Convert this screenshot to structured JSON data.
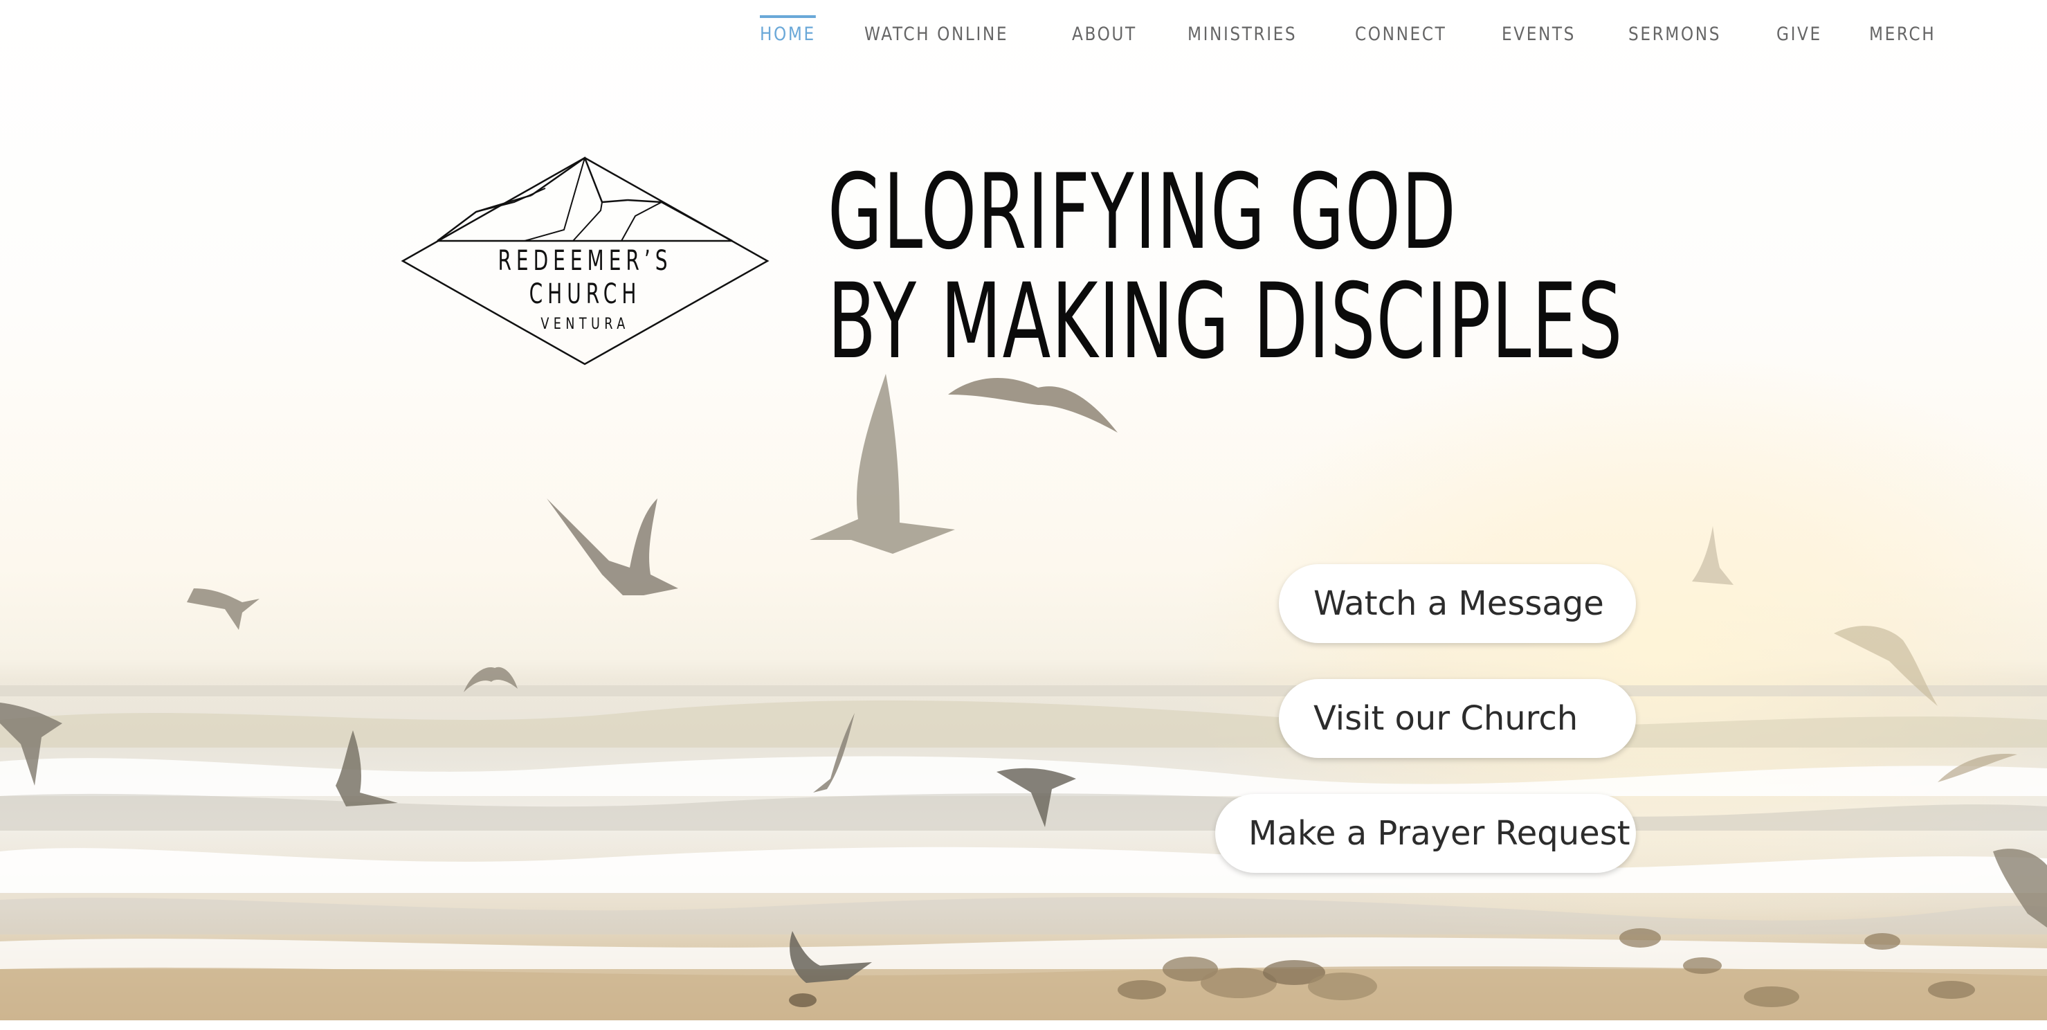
{
  "nav": {
    "items": [
      {
        "label": "HOME",
        "active": true
      },
      {
        "label": "WATCH ONLINE",
        "active": false
      },
      {
        "label": "ABOUT",
        "active": false
      },
      {
        "label": "MINISTRIES",
        "active": false
      },
      {
        "label": "CONNECT",
        "active": false
      },
      {
        "label": "EVENTS",
        "active": false
      },
      {
        "label": "SERMONS",
        "active": false
      },
      {
        "label": "GIVE",
        "active": false
      },
      {
        "label": "MERCH",
        "active": false
      }
    ],
    "active_color": "#6aa8d8",
    "text_color": "#666666"
  },
  "logo": {
    "line1": "REDEEMER’S",
    "line2": "CHURCH",
    "line3": "VENTURA",
    "icon": "mountain-diamond-logo-icon"
  },
  "hero": {
    "headline_line1": "GLORIFYING GOD",
    "headline_line2": "BY MAKING DISCIPLES",
    "background": "beach-seagulls-photo"
  },
  "cta": {
    "watch_label": "Watch a Message",
    "visit_label": "Visit our Church",
    "prayer_label": "Make a Prayer Request"
  }
}
